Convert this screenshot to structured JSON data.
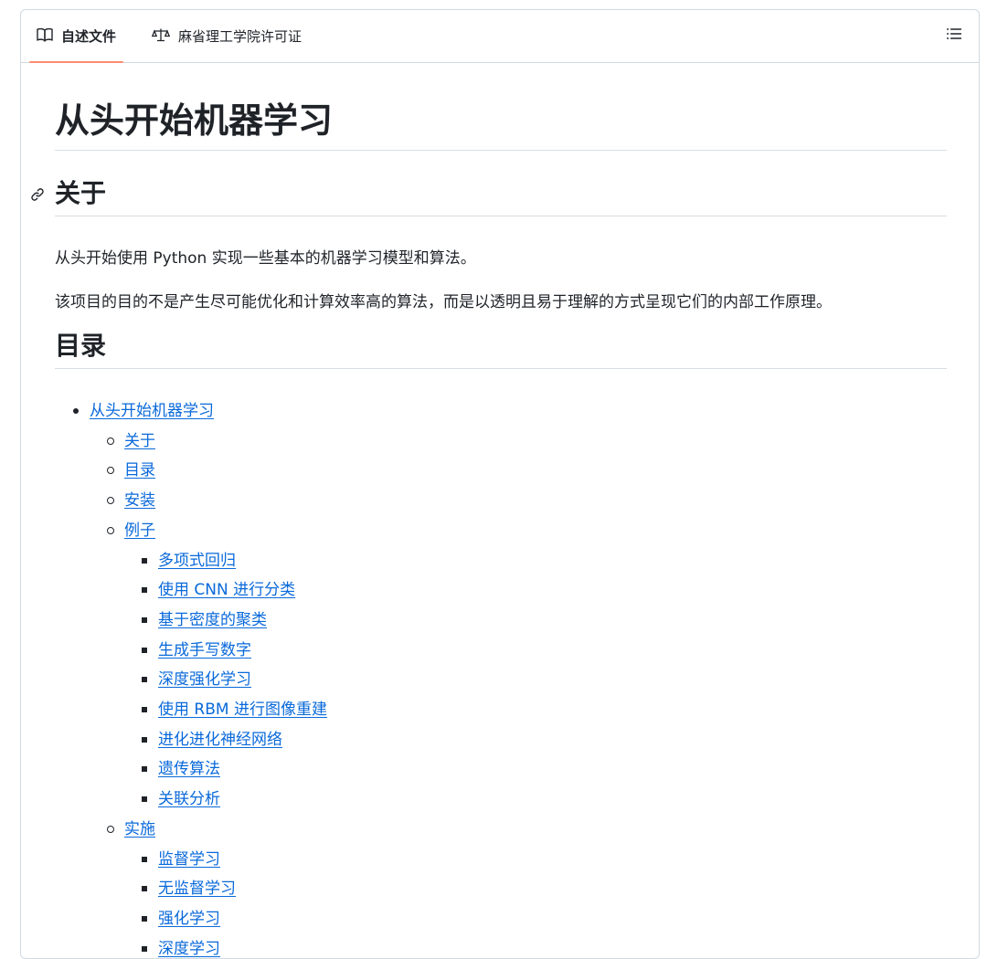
{
  "tabs": [
    {
      "label": "自述文件",
      "icon": "book-icon",
      "active": true
    },
    {
      "label": "麻省理工学院许可证",
      "icon": "scale-icon",
      "active": false
    }
  ],
  "outline_icon": "list-icon",
  "accent_color": "#fd8c73",
  "link_color": "#0969da",
  "readme": {
    "title": "从头开始机器学习",
    "about": {
      "heading": "关于",
      "p1": "从头开始使用 Python 实现一些基本的机器学习模型和算法。",
      "p2": "该项目的目的不是产生尽可能优化和计算效率高的算法，而是以透明且易于理解的方式呈现它们的内部工作原理。"
    },
    "toc": {
      "heading": "目录",
      "items": [
        {
          "level": 1,
          "label": "从头开始机器学习"
        },
        {
          "level": 2,
          "label": "关于"
        },
        {
          "level": 2,
          "label": "目录"
        },
        {
          "level": 2,
          "label": "安装"
        },
        {
          "level": 2,
          "label": "例子"
        },
        {
          "level": 3,
          "label": "多项式回归"
        },
        {
          "level": 3,
          "label": "使用 CNN 进行分类"
        },
        {
          "level": 3,
          "label": "基于密度的聚类"
        },
        {
          "level": 3,
          "label": "生成手写数字"
        },
        {
          "level": 3,
          "label": "深度强化学习"
        },
        {
          "level": 3,
          "label": "使用 RBM 进行图像重建"
        },
        {
          "level": 3,
          "label": "进化进化神经网络"
        },
        {
          "level": 3,
          "label": "遗传算法"
        },
        {
          "level": 3,
          "label": "关联分析"
        },
        {
          "level": 2,
          "label": "实施"
        },
        {
          "level": 3,
          "label": "监督学习"
        },
        {
          "level": 3,
          "label": "无监督学习"
        },
        {
          "level": 3,
          "label": "强化学习"
        },
        {
          "level": 3,
          "label": "深度学习"
        }
      ]
    }
  }
}
